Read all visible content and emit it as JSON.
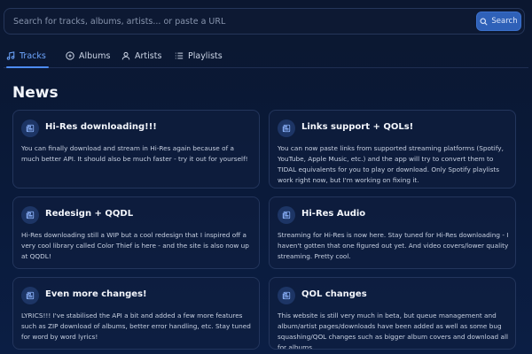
{
  "search": {
    "placeholder": "Search for tracks, albums, artists... or paste a URL",
    "button_label": "Search"
  },
  "tabs": [
    {
      "label": "Tracks",
      "icon": "music-note-icon",
      "active": true
    },
    {
      "label": "Albums",
      "icon": "disc-icon",
      "active": false
    },
    {
      "label": "Artists",
      "icon": "user-icon",
      "active": false
    },
    {
      "label": "Playlists",
      "icon": "list-icon",
      "active": false
    }
  ],
  "news": {
    "heading": "News",
    "items": [
      {
        "title": "Hi-Res downloading!!!",
        "body": "You can finally download and stream in Hi-Res again because of a much better API. It should also be much faster - try it out for yourself!"
      },
      {
        "title": "Links support + QOLs!",
        "body": "You can now paste links from supported streaming platforms (Spotify, YouTube, Apple Music, etc.) and the app will try to convert them to TIDAL equivalents for you to play or download. Only Spotify playlists work right now, but I'm working on fixing it."
      },
      {
        "title": "Redesign + QQDL",
        "body": "Hi-Res downloading still a WIP but a cool redesign that I inspired off a very cool library called Color Thief is here - and the site is also now up at QQDL!"
      },
      {
        "title": "Hi-Res Audio",
        "body": "Streaming for Hi-Res is now here. Stay tuned for Hi-Res downloading - I haven't gotten that one figured out yet. And video covers/lower quality streaming. Pretty cool."
      },
      {
        "title": "Even more changes!",
        "body": "LYRICS!!! I've stabilised the API a bit and added a few more features such as ZIP download of albums, better error handling, etc. Stay tuned for word by word lyrics!"
      },
      {
        "title": "QOL changes",
        "body": "This website is still very much in beta, but queue management and album/artist pages/downloads have been added as well as some bug squashing/QOL changes such as bigger album covers and download all for albums."
      }
    ]
  },
  "colors": {
    "accent": "#4d8cf5",
    "background": "#0a1a3a",
    "card_border": "#23355c"
  }
}
